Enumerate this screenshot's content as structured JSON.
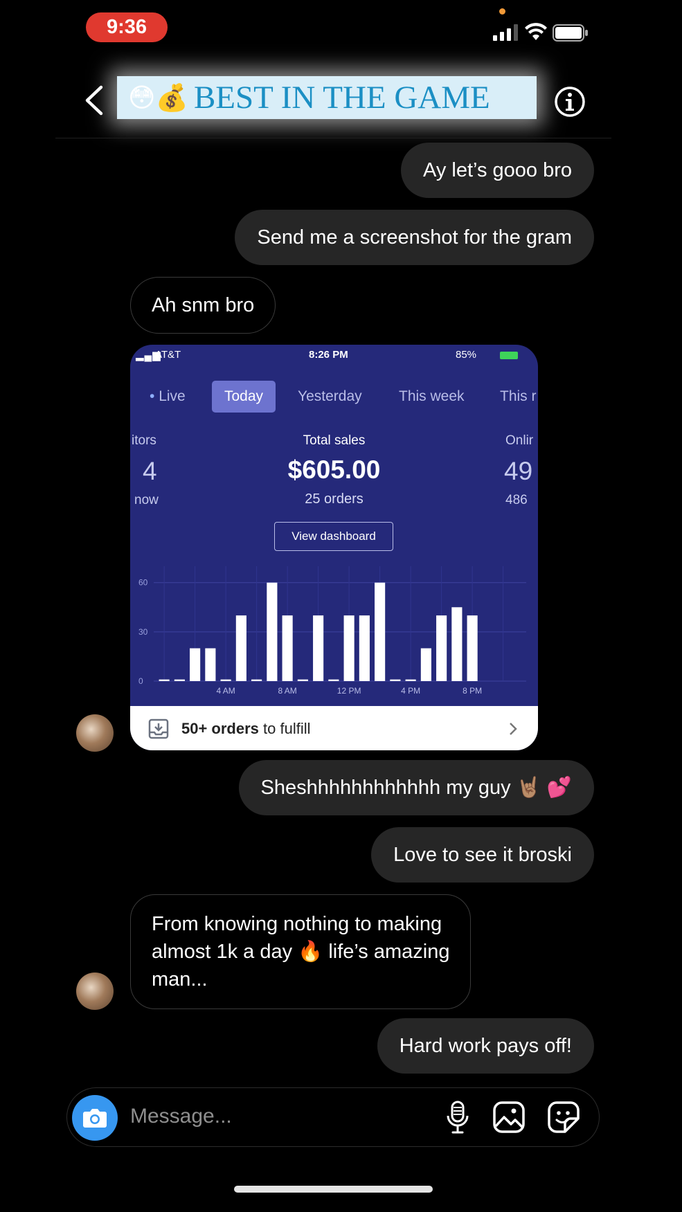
{
  "status_bar": {
    "time": "9:36"
  },
  "header": {
    "title_emojis": "😳💰",
    "title": "BEST IN THE GAME"
  },
  "messages": [
    {
      "side": "out",
      "text": "Ay let’s gooo bro"
    },
    {
      "side": "out",
      "text": "Send me a screenshot for the gram"
    },
    {
      "side": "in",
      "text": "Ah snm bro"
    },
    {
      "side": "in",
      "type": "image"
    },
    {
      "side": "out",
      "text": "Sheshhhhhhhhhhhh my guy 🤘🏽 💕"
    },
    {
      "side": "out",
      "text": "Love to see it broski"
    },
    {
      "side": "in",
      "lines": [
        "From knowing nothing to making",
        "almost 1k a day 🔥 life’s amazing",
        "man..."
      ]
    },
    {
      "side": "out",
      "text": "Hard work pays off!"
    }
  ],
  "shared_screenshot": {
    "carrier": "AT&T",
    "time": "8:26 PM",
    "battery": "85%",
    "tabs": [
      "Live",
      "Today",
      "Yesterday",
      "This week",
      "This r"
    ],
    "active_tab": "Today",
    "left_stat": {
      "label": "itors",
      "value": "4",
      "sub": "now"
    },
    "center_stat": {
      "label": "Total sales",
      "value": "$605.00",
      "sub": "25 orders"
    },
    "right_stat": {
      "label": "Onlir",
      "value": "49",
      "sub": "486"
    },
    "dashboard_button": "View dashboard",
    "footer_bold": "50+ orders",
    "footer_rest": " to fulfill",
    "chart_data": {
      "type": "bar",
      "categories": [
        "12 AM",
        "1 AM",
        "2 AM",
        "3 AM",
        "4 AM",
        "5 AM",
        "6 AM",
        "7 AM",
        "8 AM",
        "9 AM",
        "10 AM",
        "11 AM",
        "12 PM",
        "1 PM",
        "2 PM",
        "3 PM",
        "4 PM",
        "5 PM",
        "6 PM",
        "7 PM",
        "8 PM",
        "9 PM",
        "10 PM",
        "11 PM"
      ],
      "values": [
        1,
        1,
        20,
        20,
        1,
        40,
        1,
        60,
        40,
        1,
        40,
        1,
        40,
        40,
        60,
        1,
        1,
        20,
        40,
        45,
        40,
        0,
        0,
        0
      ],
      "ylim": [
        0,
        70
      ],
      "yticks": [
        "0",
        "30",
        "60"
      ],
      "ytick_values": [
        0,
        30,
        60
      ],
      "xticks": [
        "4 AM",
        "8 AM",
        "12 PM",
        "4 PM",
        "8 PM"
      ],
      "xtick_index": [
        4,
        8,
        12,
        16,
        20
      ],
      "grid": true
    }
  },
  "composer": {
    "placeholder": "Message..."
  }
}
